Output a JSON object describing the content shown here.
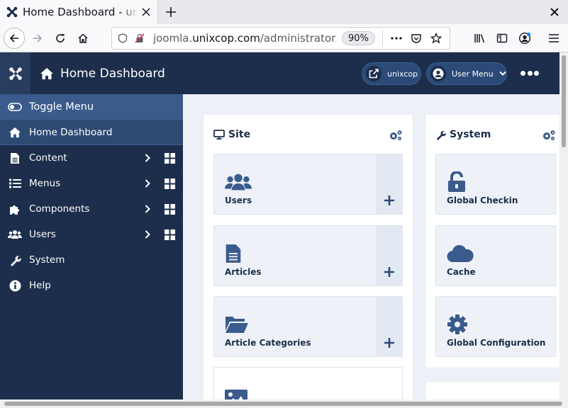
{
  "browser": {
    "tab_title": "Home Dashboard - unixcop",
    "url_prefix": "joomla.",
    "url_domain": "unixcop.com",
    "url_path": "/administrator/index.php",
    "zoom": "90%"
  },
  "header": {
    "title": "Home Dashboard",
    "site_label": "unixcop",
    "user_menu_label": "User Menu"
  },
  "sidebar": {
    "toggle_label": "Toggle Menu",
    "items": [
      {
        "label": "Home Dashboard",
        "icon": "home-icon"
      },
      {
        "label": "Content",
        "icon": "file-icon"
      },
      {
        "label": "Menus",
        "icon": "list-icon"
      },
      {
        "label": "Components",
        "icon": "puzzle-icon"
      },
      {
        "label": "Users",
        "icon": "users-icon"
      },
      {
        "label": "System",
        "icon": "wrench-icon"
      },
      {
        "label": "Help",
        "icon": "info-icon"
      }
    ]
  },
  "site_card": {
    "title": "Site",
    "modules": [
      {
        "label": "Users",
        "icon": "users-icon"
      },
      {
        "label": "Articles",
        "icon": "file-icon"
      },
      {
        "label": "Article Categories",
        "icon": "folder-open-icon"
      },
      {
        "label": "",
        "icon": "image-icon"
      }
    ]
  },
  "system_card": {
    "title": "System",
    "modules": [
      {
        "label": "Global Checkin",
        "icon": "unlock-icon"
      },
      {
        "label": "Cache",
        "icon": "cloud-icon"
      },
      {
        "label": "Global Configuration",
        "icon": "gear-icon"
      }
    ]
  },
  "colors": {
    "header_bg": "#1c2e4b",
    "toggle_bg": "#3b5b8c",
    "main_bg": "#edf1f7",
    "module_bg": "#eef2f8"
  }
}
